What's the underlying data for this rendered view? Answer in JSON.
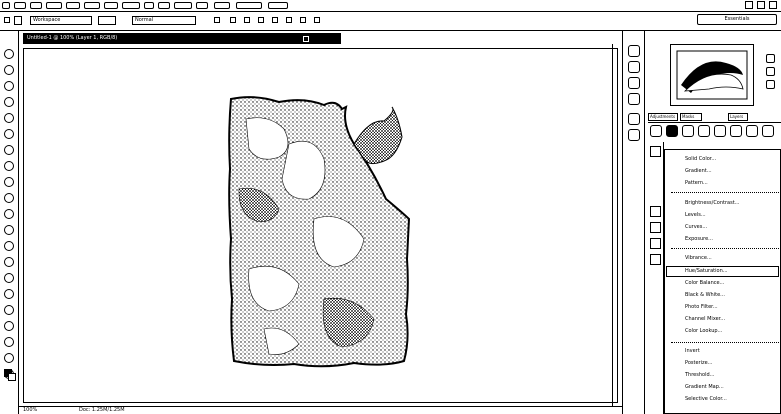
{
  "document": {
    "tab_title": "Untitled-1 @ 100% (Layer 1, RGB/8)",
    "zoom": "100%",
    "status": "Doc: 1.25M/1.25M"
  },
  "menu": {
    "items": [
      "Ps",
      "File",
      "Edit",
      "Image",
      "Layer",
      "Select",
      "Filter",
      "Analysis",
      "3D",
      "View",
      "Window",
      "Help"
    ]
  },
  "options": {
    "preset_label": "Workspace",
    "tool_field": "Normal",
    "workspace_button": "Essentials"
  },
  "panels": {
    "tabs": [
      "Adjustments",
      "Masks"
    ],
    "layers_title": "Layers"
  },
  "adjustment_menu": {
    "items": [
      "Solid Color...",
      "Gradient...",
      "Pattern...",
      "Brightness/Contrast...",
      "Levels...",
      "Curves...",
      "Exposure...",
      "Vibrance...",
      "Hue/Saturation...",
      "Color Balance...",
      "Black & White...",
      "Photo Filter...",
      "Channel Mixer...",
      "Color Lookup...",
      "Invert",
      "Posterize...",
      "Threshold...",
      "Gradient Map...",
      "Selective Color..."
    ],
    "highlighted": "Hue/Saturation..."
  },
  "colors": {
    "ink": "#000000",
    "paper": "#ffffff"
  }
}
